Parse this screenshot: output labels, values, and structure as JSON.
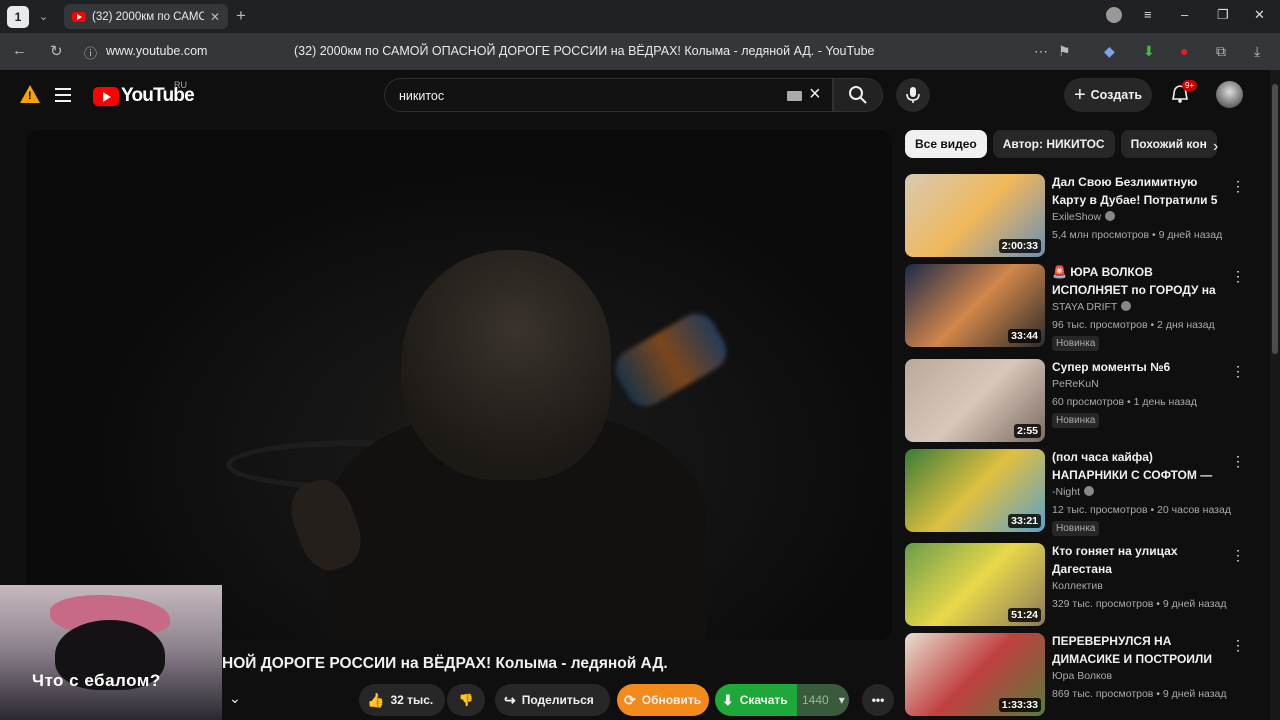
{
  "browser": {
    "workspace_label": "1",
    "tab_title": "(32) 2000км по САМОЙ",
    "url": "www.youtube.com",
    "page_title": "(32) 2000км по САМОЙ ОПАСНОЙ ДОРОГЕ РОССИИ на ВЁДРАХ! Колыма - ледяной АД. - YouTube"
  },
  "header": {
    "logo_text": "YouTube",
    "region": "RU",
    "search_value": "никитос",
    "create_label": "Создать",
    "notif_count": "9+"
  },
  "video": {
    "title": "НОЙ ДОРОГЕ РОССИИ на ВЁДРАХ! Колыма - ледяной АД.",
    "overlay_caption": "Что с ебалом?",
    "like_count": "32 тыс.",
    "share_label": "Поделиться",
    "refresh_label": "Обновить",
    "download_label": "Скачать",
    "quality": "1440"
  },
  "chips": [
    "Все видео",
    "Автор: НИКИТОС",
    "Похожий кон"
  ],
  "recommendations": [
    {
      "title": "Дал Свою Безлимитную Карту в Дубае! Потратили 5 ...",
      "channel": "ExileShow",
      "verified": true,
      "meta": "5,4 млн просмотров • 9 дней назад",
      "duration": "2:00:33",
      "new_badge": "",
      "thumb_colors": [
        "#d8c9b5",
        "#f0b85a",
        "#6b8fb5"
      ]
    },
    {
      "title": "🚨 ЮРА ВОЛКОВ ИСПОЛНЯЕТ по ГОРОДУ на ВАЗ-21099 ...",
      "channel": "STAYA DRIFT",
      "verified": true,
      "meta": "96 тыс. просмотров • 2 дня назад",
      "duration": "33:44",
      "new_badge": "Новинка",
      "thumb_colors": [
        "#1c2a4a",
        "#d2864a",
        "#2c2c2c"
      ]
    },
    {
      "title": "Супер моменты №6",
      "channel": "PeReKuN",
      "verified": false,
      "meta": "60 просмотров • 1 день назад",
      "duration": "2:55",
      "new_badge": "Новинка",
      "thumb_colors": [
        "#bba89a",
        "#d8c8bb",
        "#7a6a60"
      ]
    },
    {
      "title": "(пол часа кайфа) НАПАРНИКИ С СОФТОМ — ...",
      "channel": "-Night",
      "verified": true,
      "meta": "12 тыс. просмотров • 20 часов назад",
      "duration": "33:21",
      "new_badge": "Новинка",
      "thumb_colors": [
        "#3a7d3a",
        "#e0c040",
        "#5aa0c8"
      ]
    },
    {
      "title": "Кто гоняет на улицах Дагестана",
      "channel": "Коллектив",
      "verified": false,
      "meta": "329 тыс. просмотров • 9 дней назад",
      "duration": "51:24",
      "new_badge": "",
      "thumb_colors": [
        "#6a9c4a",
        "#e8d84a",
        "#8a7a5a"
      ]
    },
    {
      "title": "ПЕРЕВЕРНУЛСЯ НА ДИМАСИКЕ И ПОСТРОИЛИ ...",
      "channel": "Юра Волков",
      "verified": false,
      "meta": "869 тыс. просмотров • 9 дней назад",
      "duration": "1:33:33",
      "new_badge": "",
      "thumb_colors": [
        "#e8e0d0",
        "#c04040",
        "#5a7a3a"
      ]
    }
  ]
}
